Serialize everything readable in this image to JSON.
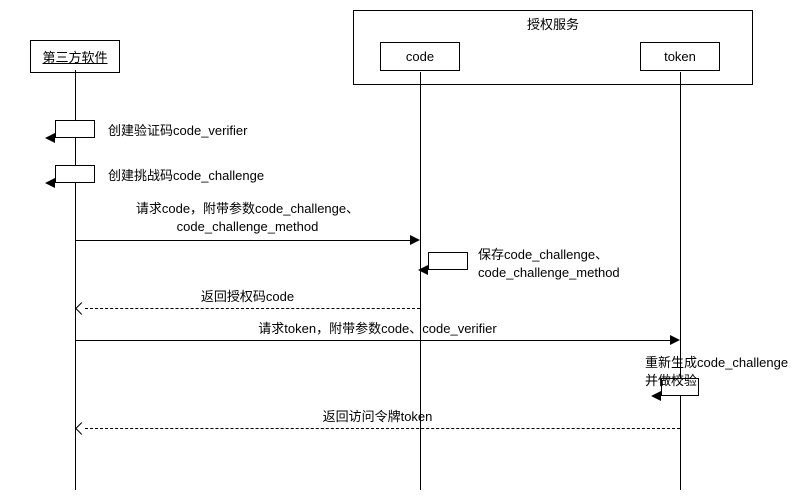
{
  "participants": {
    "client": "第三方软件",
    "container": "授权服务",
    "code": "code",
    "token": "token"
  },
  "messages": {
    "m1": "创建验证码code_verifier",
    "m2": "创建挑战码code_challenge",
    "m3": "请求code，附带参数code_challenge、\ncode_challenge_method",
    "m4": "保存code_challenge、\ncode_challenge_method",
    "m5": "返回授权码code",
    "m6": "请求token，附带参数code、code_verifier",
    "m7": "重新生成code_challenge\n并做校验",
    "m8": "返回访问令牌token"
  },
  "chart_data": {
    "type": "sequence_diagram",
    "participants": [
      {
        "id": "client",
        "label": "第三方软件"
      },
      {
        "id": "code",
        "label": "code",
        "parent": "auth_service"
      },
      {
        "id": "token",
        "label": "token",
        "parent": "auth_service"
      }
    ],
    "containers": [
      {
        "id": "auth_service",
        "label": "授权服务",
        "children": [
          "code",
          "token"
        ]
      }
    ],
    "messages": [
      {
        "from": "client",
        "to": "client",
        "text": "创建验证码code_verifier",
        "kind": "self"
      },
      {
        "from": "client",
        "to": "client",
        "text": "创建挑战码code_challenge",
        "kind": "self"
      },
      {
        "from": "client",
        "to": "code",
        "text": "请求code，附带参数code_challenge、code_challenge_method",
        "kind": "sync"
      },
      {
        "from": "code",
        "to": "code",
        "text": "保存code_challenge、code_challenge_method",
        "kind": "self"
      },
      {
        "from": "code",
        "to": "client",
        "text": "返回授权码code",
        "kind": "return"
      },
      {
        "from": "client",
        "to": "token",
        "text": "请求token，附带参数code、code_verifier",
        "kind": "sync"
      },
      {
        "from": "token",
        "to": "token",
        "text": "重新生成code_challenge 并做校验",
        "kind": "self"
      },
      {
        "from": "token",
        "to": "client",
        "text": "返回访问令牌token",
        "kind": "return"
      }
    ]
  }
}
